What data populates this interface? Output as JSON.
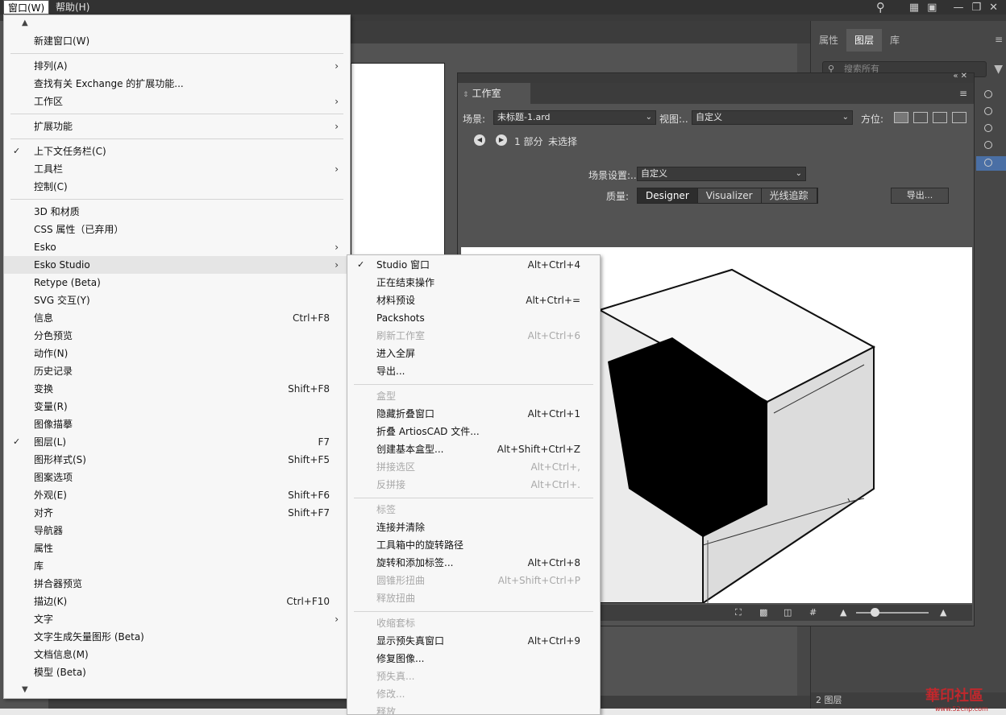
{
  "menubar": {
    "items": [
      "窗口(W)",
      "帮助(H)"
    ]
  },
  "right_panel": {
    "tabs": [
      "属性",
      "图层",
      "库"
    ],
    "search_placeholder": "搜索所有",
    "footer": "2 图层"
  },
  "studio": {
    "title": "工作室",
    "scene_label": "场景:",
    "scene_value": "未标题-1.ard",
    "view_label": "视图:..",
    "view_value": "自定义",
    "position_label": "方位:",
    "part_count": "1 部分",
    "selection": "未选择",
    "scene_settings_label": "场景设置:..",
    "scene_settings_value": "自定义",
    "quality_label": "质量:",
    "quality_options": [
      "Designer",
      "Visualizer",
      "光线追踪"
    ],
    "export_button": "导出..."
  },
  "menu": {
    "items": [
      {
        "label": "新建窗口(W)"
      },
      {
        "label": "排列(A)"
      },
      {
        "label": "查找有关 Exchange 的扩展功能..."
      },
      {
        "label": "工作区"
      },
      {
        "label": "扩展功能"
      },
      {
        "label": "上下文任务栏(C)"
      },
      {
        "label": "工具栏"
      },
      {
        "label": "控制(C)"
      },
      {
        "label": "3D 和材质"
      },
      {
        "label": "CSS 属性（已弃用）"
      },
      {
        "label": "Esko"
      },
      {
        "label": "Esko Studio"
      },
      {
        "label": "Retype (Beta)"
      },
      {
        "label": "SVG 交互(Y)"
      },
      {
        "label": "信息",
        "shortcut": "Ctrl+F8"
      },
      {
        "label": "分色预览"
      },
      {
        "label": "动作(N)"
      },
      {
        "label": "历史记录"
      },
      {
        "label": "变换",
        "shortcut": "Shift+F8"
      },
      {
        "label": "变量(R)"
      },
      {
        "label": "图像描摹"
      },
      {
        "label": "图层(L)",
        "shortcut": "F7"
      },
      {
        "label": "图形样式(S)",
        "shortcut": "Shift+F5"
      },
      {
        "label": "图案选项"
      },
      {
        "label": "外观(E)",
        "shortcut": "Shift+F6"
      },
      {
        "label": "对齐",
        "shortcut": "Shift+F7"
      },
      {
        "label": "导航器"
      },
      {
        "label": "属性"
      },
      {
        "label": "库"
      },
      {
        "label": "拼合器预览"
      },
      {
        "label": "描边(K)",
        "shortcut": "Ctrl+F10"
      },
      {
        "label": "文字"
      },
      {
        "label": "文字生成矢量图形 (Beta)"
      },
      {
        "label": "文档信息(M)"
      },
      {
        "label": "模型 (Beta)"
      }
    ]
  },
  "submenu": {
    "items": [
      {
        "label": "Studio 窗口",
        "shortcut": "Alt+Ctrl+4"
      },
      {
        "label": "正在结束操作"
      },
      {
        "label": "材料预设",
        "shortcut": "Alt+Ctrl+="
      },
      {
        "label": "Packshots"
      },
      {
        "label": "刷新工作室",
        "shortcut": "Alt+Ctrl+6"
      },
      {
        "label": "进入全屏"
      },
      {
        "label": "导出..."
      },
      {
        "label": "盒型"
      },
      {
        "label": "隐藏折叠窗口",
        "shortcut": "Alt+Ctrl+1"
      },
      {
        "label": "折叠 ArtiosCAD 文件..."
      },
      {
        "label": "创建基本盒型...",
        "shortcut": "Alt+Shift+Ctrl+Z"
      },
      {
        "label": "拼接选区",
        "shortcut": "Alt+Ctrl+,"
      },
      {
        "label": "反拼接",
        "shortcut": "Alt+Ctrl+."
      },
      {
        "label": "标签"
      },
      {
        "label": "连接并清除"
      },
      {
        "label": "工具箱中的旋转路径"
      },
      {
        "label": "旋转和添加标签...",
        "shortcut": "Alt+Ctrl+8"
      },
      {
        "label": "圆锥形扭曲",
        "shortcut": "Alt+Shift+Ctrl+P"
      },
      {
        "label": "释放扭曲"
      },
      {
        "label": "收缩套标"
      },
      {
        "label": "显示预失真窗口",
        "shortcut": "Alt+Ctrl+9"
      },
      {
        "label": "修复图像..."
      },
      {
        "label": "预失真..."
      },
      {
        "label": "修改..."
      },
      {
        "label": "释放"
      }
    ]
  },
  "watermark": {
    "text": "華印社區",
    "url": "www.52cnp.com"
  }
}
